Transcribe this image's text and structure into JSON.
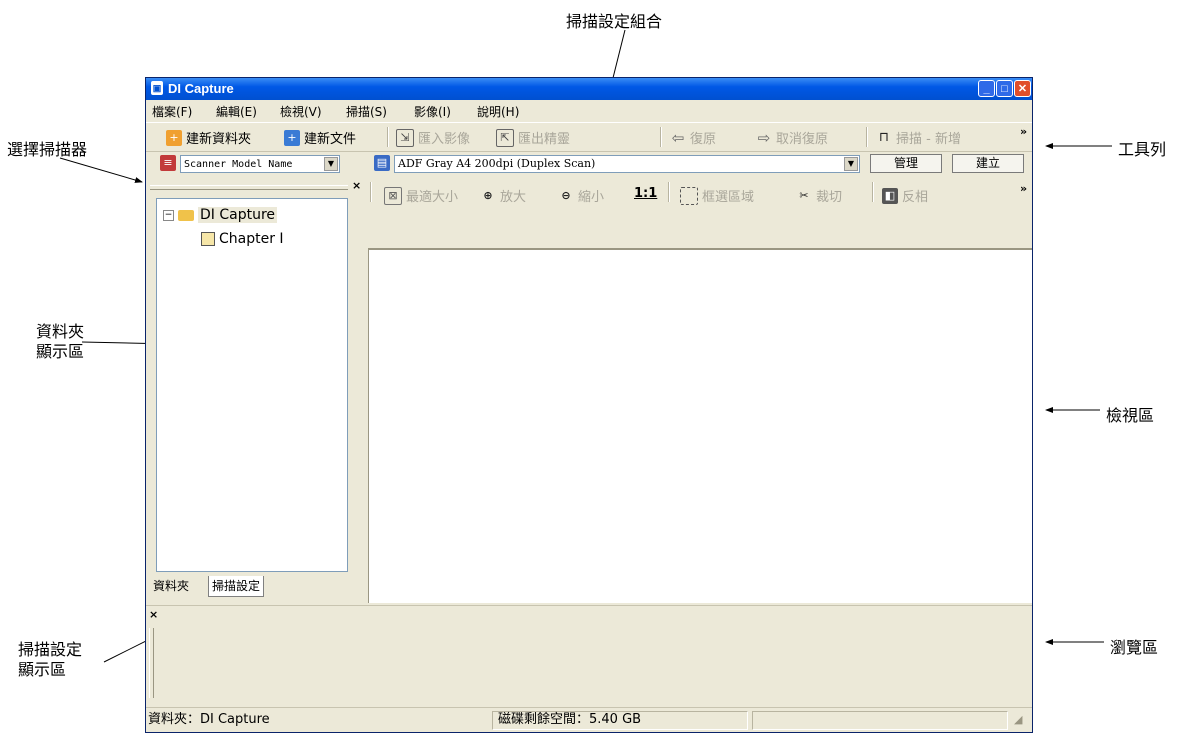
{
  "callouts": {
    "scan_profile": "掃描設定組合",
    "select_scanner": "選擇掃描器",
    "toolbar": "工具列",
    "folder_area_1": "資料夾",
    "folder_area_2": "顯示區",
    "view_area": "檢視區",
    "scan_settings_1": "掃描設定",
    "scan_settings_2": "顯示區",
    "preview_area": "瀏覽區"
  },
  "window": {
    "title": "DI Capture",
    "menu": [
      "檔案(F)",
      "編輯(E)",
      "檢視(V)",
      "掃描(S)",
      "影像(I)",
      "說明(H)"
    ]
  },
  "toolbar": {
    "new_folder": "建新資料夾",
    "new_document": "建新文件",
    "import_image": "匯入影像",
    "export_thumb": "匯出精靈",
    "undo": "復原",
    "redo": "取消復原",
    "scan_new": "掃描 - 新增",
    "more": "»"
  },
  "scanner_bar": {
    "scanner_name": "Scanner Model Name",
    "scan_profile": "ADF Gray A4 200dpi  (Duplex Scan)",
    "manage": "管理",
    "create": "建立"
  },
  "view_toolbar": {
    "fit": "最適大小",
    "zoom_in": "放大",
    "zoom_out": "縮小",
    "actual": "1:1",
    "select_area": "框選區域",
    "crop": "裁切",
    "invert": "反相",
    "more": "»"
  },
  "folder_tree": {
    "root": "DI Capture",
    "child": "Chapter I"
  },
  "left_tabs": [
    "資料夾",
    "掃描設定"
  ],
  "status": {
    "folder": "資料夾：DI Capture",
    "disk": "磁碟剩餘空間：5.40 GB"
  },
  "colors": {
    "titlebar": "#0058e6",
    "chrome": "#ece9d8",
    "folder": "#f0c24a"
  }
}
